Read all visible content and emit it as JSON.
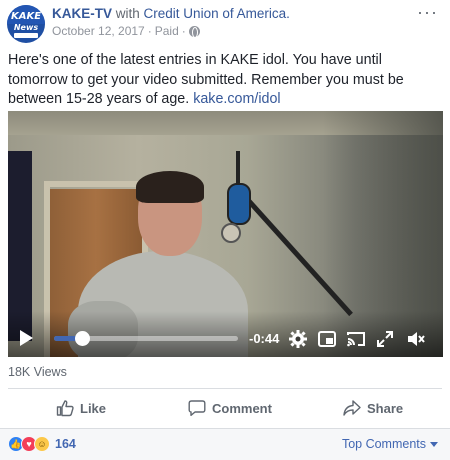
{
  "header": {
    "avatar_text_top": "KAKE",
    "avatar_text_bottom": "News",
    "page_name": "KAKE-TV",
    "with_text": "with",
    "partner_name": "Credit Union of America.",
    "date": "October 12, 2017",
    "separator1": "·",
    "paid_label": "Paid",
    "separator2": "·",
    "privacy_icon": "globe-icon",
    "more_label": "···"
  },
  "post": {
    "text": "Here's one of the latest entries in KAKE idol. You have until tomorrow to get your video submitted. Remember you must be between 15-28 years of age.",
    "link_text": "kake.com/idol"
  },
  "video": {
    "time_remaining": "-0:44",
    "progress": 0.15,
    "controls": [
      "play-icon",
      "settings-icon",
      "picture-in-picture-icon",
      "cast-icon",
      "fullscreen-icon",
      "mute-icon"
    ]
  },
  "stats": {
    "views": "18K Views"
  },
  "actions": {
    "like": "Like",
    "comment": "Comment",
    "share": "Share"
  },
  "footer": {
    "reaction_icons": [
      "like-reaction-icon",
      "love-reaction-icon",
      "haha-reaction-icon"
    ],
    "reaction_count": "164",
    "top_comments": "Top Comments"
  },
  "colors": {
    "link": "#365899",
    "facebook_blue": "#4267b2",
    "meta_gray": "#90949c"
  }
}
